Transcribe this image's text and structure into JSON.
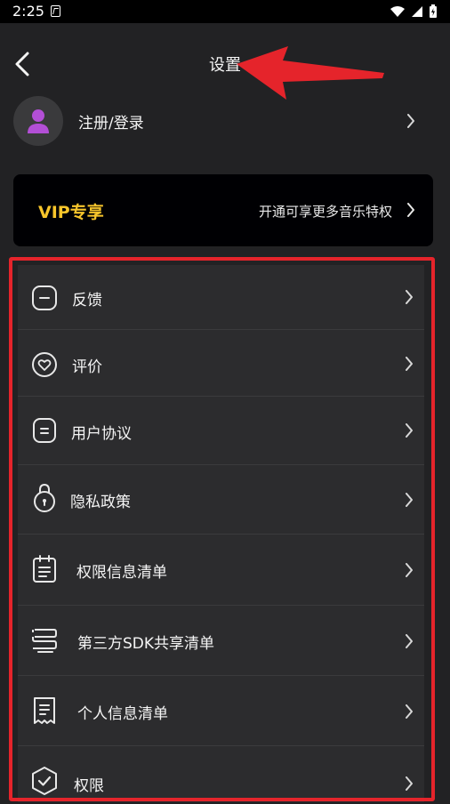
{
  "status_bar": {
    "time": "2:25"
  },
  "header": {
    "title": "设置"
  },
  "profile": {
    "label": "注册/登录"
  },
  "vip": {
    "title": "VIP专享",
    "description": "开通可享更多音乐特权"
  },
  "menu": [
    {
      "label": "反馈",
      "icon": "feedback-icon"
    },
    {
      "label": "评价",
      "icon": "heart-rating-icon"
    },
    {
      "label": "用户协议",
      "icon": "document-icon"
    },
    {
      "label": "隐私政策",
      "icon": "lock-icon"
    },
    {
      "label": "权限信息清单",
      "icon": "clipboard-list-icon"
    },
    {
      "label": "第三方SDK共享清单",
      "icon": "stack-list-icon"
    },
    {
      "label": "个人信息清单",
      "icon": "receipt-icon"
    },
    {
      "label": "权限",
      "icon": "shield-check-icon"
    }
  ],
  "colors": {
    "vip_gold": "#f7c52b",
    "annotation_red": "#e5242b",
    "avatar_purple": "#b34fd6"
  }
}
